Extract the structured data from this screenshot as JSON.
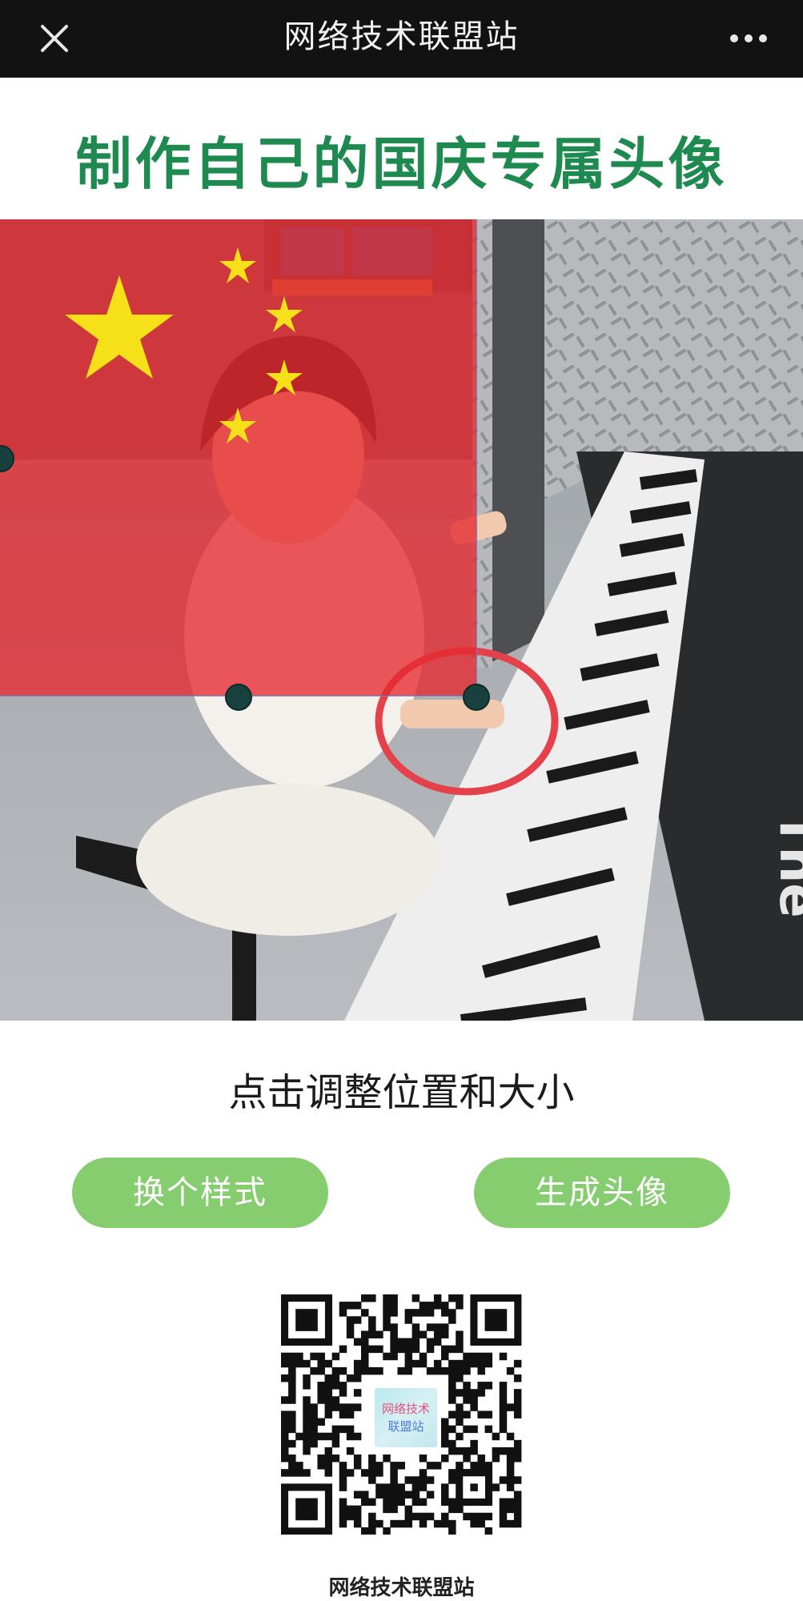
{
  "header": {
    "title": "网络技术联盟站",
    "close_icon": "close-icon",
    "more_icon": "more-horizontal-icon"
  },
  "main": {
    "heading": "制作自己的国庆专属头像",
    "hint": "点击调整位置和大小",
    "buttons": {
      "change_style": "换个样式",
      "generate_avatar": "生成头像"
    },
    "qr_logo_lines": [
      "网络技术",
      "联盟站"
    ],
    "footer_text": "网络技术联盟站"
  },
  "colors": {
    "topbar": "#121212",
    "heading": "#1f8a4f",
    "button": "#86cd6f",
    "flag_red": "#e6292f",
    "flag_star": "#f5e01a"
  }
}
